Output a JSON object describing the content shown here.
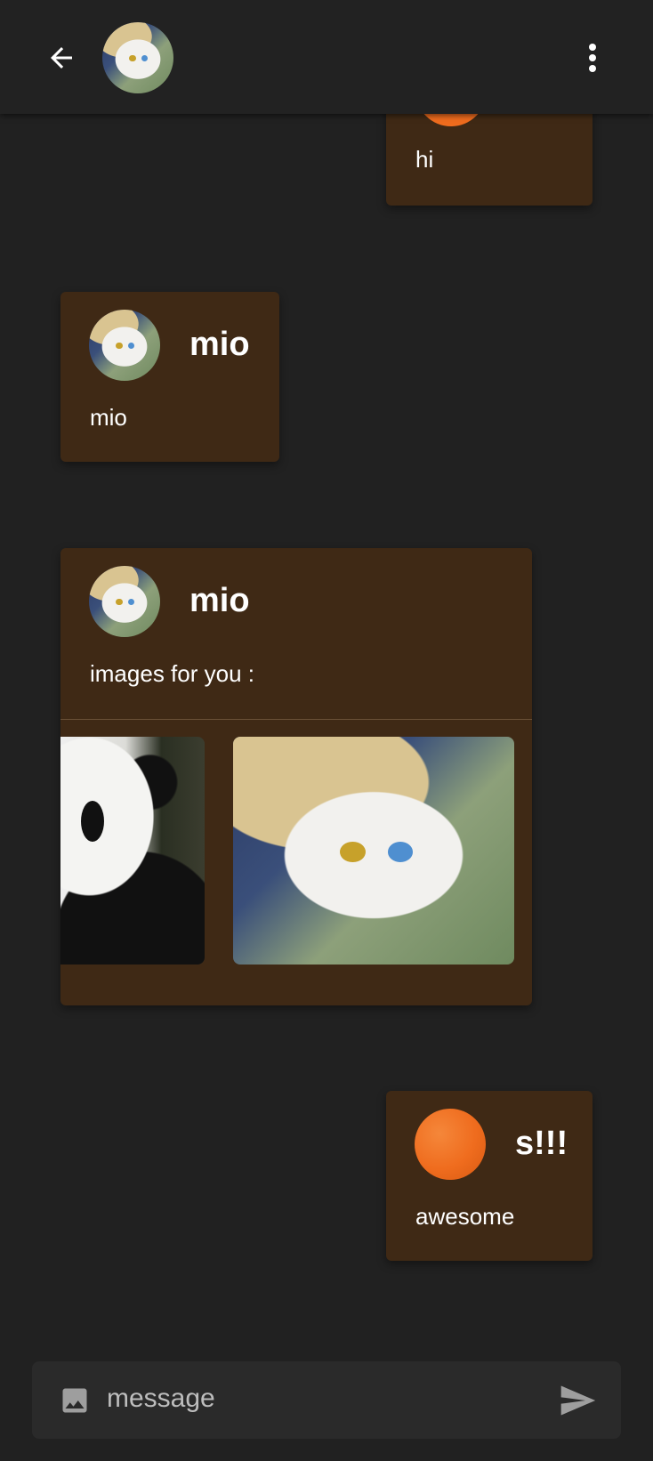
{
  "messages": [
    {
      "from": "self",
      "text": "hi"
    },
    {
      "from": "contact",
      "name": "mio",
      "text": "mio"
    },
    {
      "from": "contact",
      "name": "mio",
      "text": "images for you :",
      "images": [
        "panda-photo",
        "white-cat-photo"
      ]
    },
    {
      "from": "self",
      "name": "s!!!",
      "text": "awesome"
    }
  ],
  "composer": {
    "placeholder": "message"
  },
  "colors": {
    "background": "#212121",
    "bubble": "#3f2915",
    "appbar": "#222222",
    "avatar_orange": "#ef6c1e"
  },
  "icons": {
    "back": "arrow-left-icon",
    "menu": "more-vert-icon",
    "attach": "image-icon",
    "send": "send-icon"
  }
}
